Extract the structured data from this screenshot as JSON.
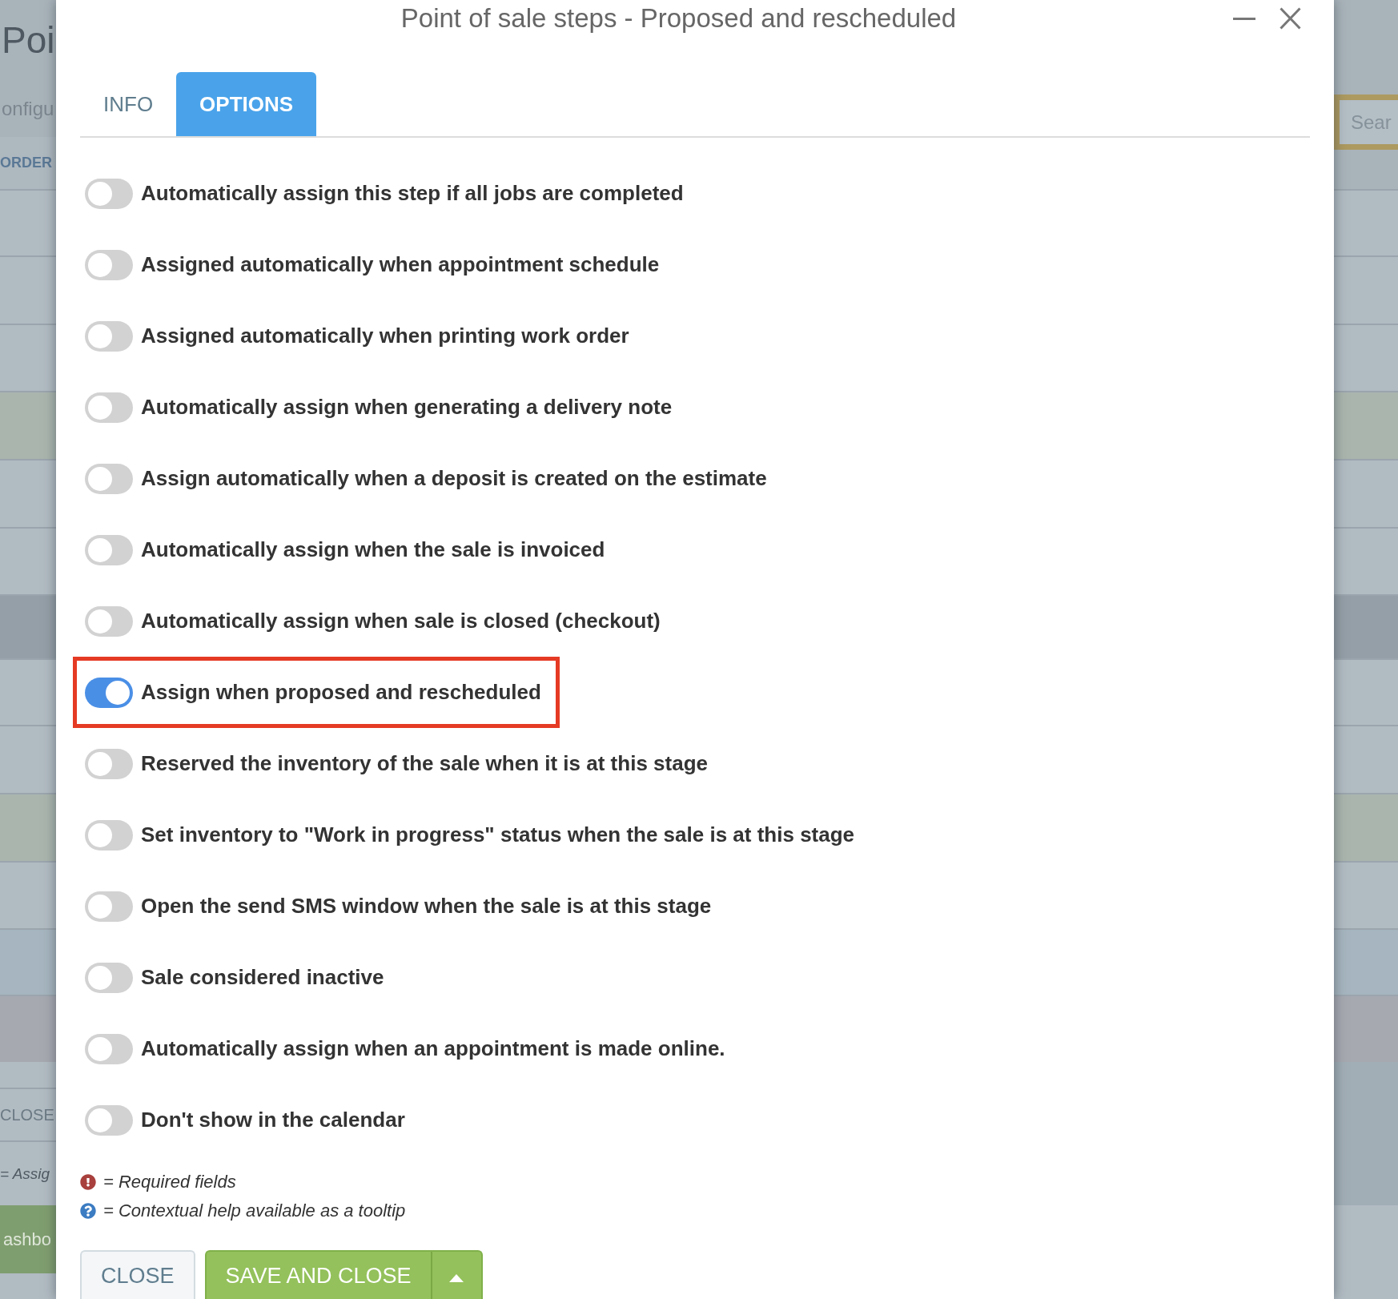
{
  "background_page": {
    "heading": "Poi",
    "subheading": "onfigu",
    "table_header": "ORDER",
    "search_field": {
      "placeholder": "Sear"
    },
    "row_button": "CLOSE",
    "row_note": "= Assig",
    "footer_button": "ashbo"
  },
  "dialog": {
    "title": "Point of sale steps - Proposed and rescheduled",
    "tabs": [
      {
        "label": "INFO",
        "selected": false
      },
      {
        "label": "OPTIONS",
        "selected": true
      }
    ],
    "options": [
      {
        "label": "Automatically assign this step if all jobs are completed",
        "on": false,
        "highlighted": false
      },
      {
        "label": "Assigned automatically when appointment schedule",
        "on": false,
        "highlighted": false
      },
      {
        "label": "Assigned automatically when printing work order",
        "on": false,
        "highlighted": false
      },
      {
        "label": "Automatically assign when generating a delivery note",
        "on": false,
        "highlighted": false
      },
      {
        "label": "Assign automatically when a deposit is created on the estimate",
        "on": false,
        "highlighted": false
      },
      {
        "label": "Automatically assign when the sale is invoiced",
        "on": false,
        "highlighted": false
      },
      {
        "label": "Automatically assign when sale is closed (checkout)",
        "on": false,
        "highlighted": false
      },
      {
        "label": "Assign when proposed and rescheduled",
        "on": true,
        "highlighted": true
      },
      {
        "label": "Reserved the inventory of the sale when it is at this stage",
        "on": false,
        "highlighted": false
      },
      {
        "label": "Set inventory to \"Work in progress\" status when the sale is at this stage",
        "on": false,
        "highlighted": false
      },
      {
        "label": "Open the send SMS window when the sale is at this stage",
        "on": false,
        "highlighted": false
      },
      {
        "label": "Sale considered inactive",
        "on": false,
        "highlighted": false
      },
      {
        "label": "Automatically assign when an appointment is made online.",
        "on": false,
        "highlighted": false
      },
      {
        "label": "Don't show in the calendar",
        "on": false,
        "highlighted": false
      }
    ],
    "legend": [
      {
        "kind": "required",
        "text": "= Required fields"
      },
      {
        "kind": "help",
        "text": "= Contextual help available as a tooltip"
      }
    ],
    "buttons": [
      {
        "kind": "secondary",
        "label": "CLOSE"
      },
      {
        "kind": "primary",
        "label": "SAVE AND CLOSE"
      }
    ]
  }
}
